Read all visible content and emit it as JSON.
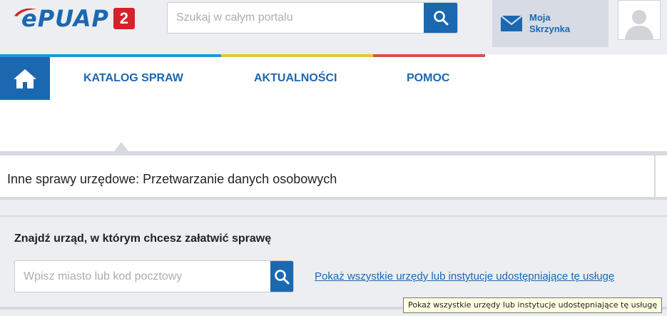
{
  "logo": {
    "text": "ePUAP",
    "badge": "2"
  },
  "search": {
    "placeholder": "Szukaj w całym portalu"
  },
  "mailbox": {
    "line1": "Moja",
    "line2": "Skrzynka"
  },
  "nav": {
    "items": [
      {
        "label": "KATALOG SPRAW"
      },
      {
        "label": "AKTUALNOŚCI"
      },
      {
        "label": "POMOC"
      }
    ]
  },
  "page": {
    "title": "Inne sprawy urzędowe: Przetwarzanie danych osobowych"
  },
  "office": {
    "heading": "Znajdź urząd, w którym chcesz załatwić sprawę",
    "placeholder": "Wpisz miasto lub kod pocztowy",
    "show_all_link": "Pokaż wszystkie urzędy lub instytucje udostępniające tę usługę"
  },
  "tooltip": {
    "text": "Pokaż wszystkie urzędy lub instytucje udostępniające tę usługę"
  },
  "colors": {
    "brand_blue": "#1b68b1",
    "strip_blue": "#1b9ad6",
    "strip_yellow": "#e8c63a",
    "strip_red": "#d5534b",
    "badge_red": "#d3222a"
  }
}
